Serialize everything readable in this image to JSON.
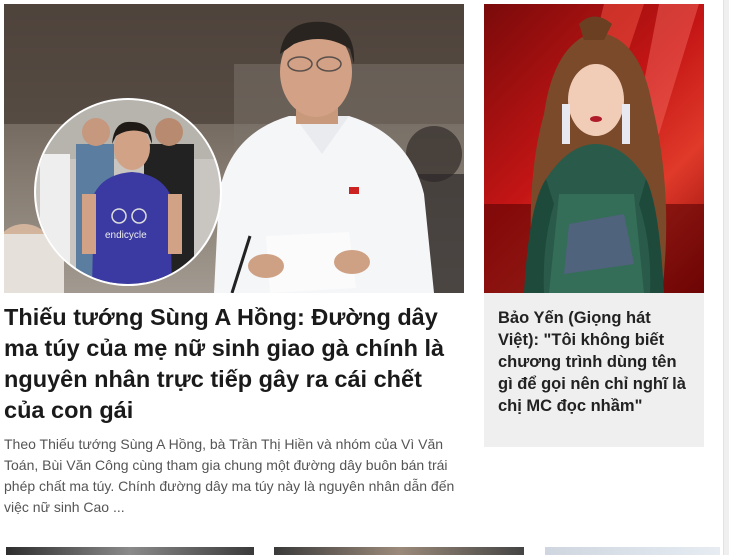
{
  "main_article": {
    "title": "Thiếu tướng Sùng A Hồng: Đường dây ma túy của mẹ nữ sinh giao gà chính là nguyên nhân trực tiếp gây ra cái chết của con gái",
    "summary": "Theo Thiếu tướng Sùng A Hồng, bà Trần Thị Hiền và nhóm của Vì Văn Toán, Bùi Văn Công cùng tham gia chung một đường dây buôn bán trái phép chất ma túy. Chính đường dây ma túy này là nguyên nhân dẫn đến việc nữ sinh Cao ...",
    "image": {
      "inset_shirt_text": "endicycle"
    }
  },
  "side_article": {
    "title": "Bảo Yến (Giọng hát Việt): \"Tôi không biết chương trình dùng tên gì để gọi nên chỉ nghĩ là chị MC đọc nhầm\""
  },
  "colors": {
    "title": "#1a1a1a",
    "summary": "#555555",
    "side_card_bg": "#efefef",
    "red_backdrop": "#c41515"
  }
}
